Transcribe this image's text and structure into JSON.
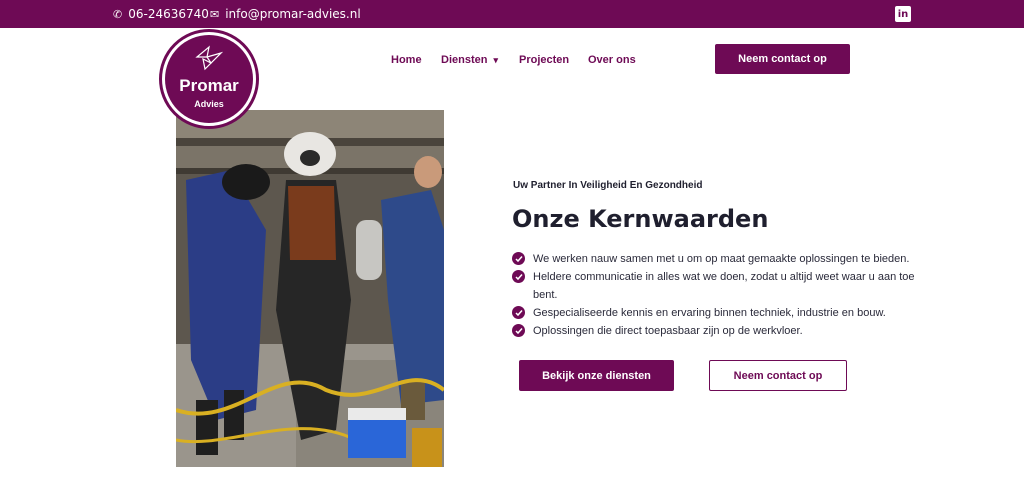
{
  "topbar": {
    "phone": "06-24636740",
    "email": "info@promar-advies.nl",
    "phone_icon": "phone-icon",
    "email_icon": "mail-icon",
    "social_icon": "linkedin-icon"
  },
  "logo": {
    "name": "Promar",
    "sub": "Advies"
  },
  "nav": {
    "home": "Home",
    "diensten": "Diensten",
    "projecten": "Projecten",
    "over": "Over ons"
  },
  "header_cta": "Neem contact op",
  "hero": {
    "tagline": "Uw Partner In Veiligheid En Gezondheid",
    "heading": "Onze Kernwaarden",
    "points": [
      "We werken nauw samen met u om op maat gemaakte oplossingen te bieden.",
      "Heldere communicatie in alles wat we doen, zodat u altijd weet waar u aan toe bent.",
      "Gespecialiseerde kennis en ervaring binnen techniek, industrie en bouw.",
      "Oplossingen die direct toepasbaar zijn op de werkvloer."
    ],
    "btn_primary": "Bekijk onze diensten",
    "btn_secondary": "Neem contact op"
  },
  "colors": {
    "brand": "#6e0a55"
  }
}
